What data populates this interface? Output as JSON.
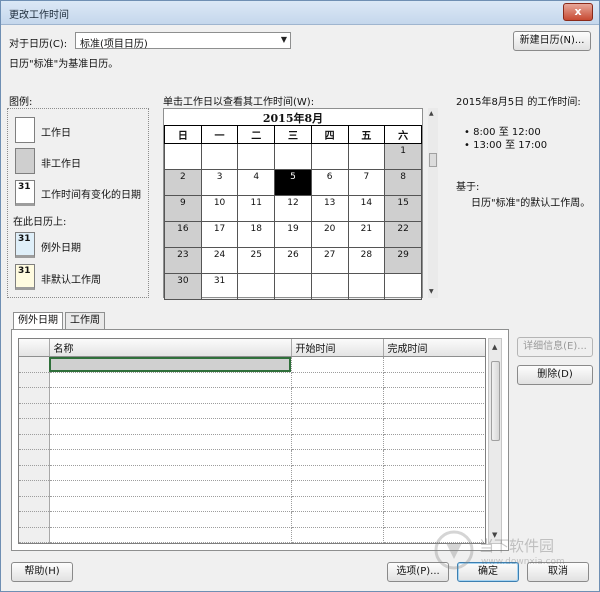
{
  "window": {
    "title": "更改工作时间",
    "close_label": "x"
  },
  "calendar_for": {
    "label": "对于日历(C):",
    "selected": "标准(项目日历)",
    "new_calendar_button": "新建日历(N)...",
    "base_info": "日历\"标准\"为基准日历。"
  },
  "legend": {
    "title": "图例:",
    "working": "工作日",
    "nonworking": "非工作日",
    "edited_swatch": "31",
    "edited": "工作时间有变化的日期",
    "on_this_calendar": "在此日历上:",
    "exception_swatch": "31",
    "exception": "例外日期",
    "nondefault_swatch": "31",
    "nondefault": "非默认工作周"
  },
  "calendar": {
    "instruction": "单击工作日以查看其工作时间(W):",
    "month_title": "2015年8月",
    "weekdays": [
      "日",
      "一",
      "二",
      "三",
      "四",
      "五",
      "六"
    ],
    "weeks": [
      [
        "",
        "",
        "",
        "",
        "",
        "",
        "1"
      ],
      [
        "2",
        "3",
        "4",
        "5",
        "6",
        "7",
        "8"
      ],
      [
        "9",
        "10",
        "11",
        "12",
        "13",
        "14",
        "15"
      ],
      [
        "16",
        "17",
        "18",
        "19",
        "20",
        "21",
        "22"
      ],
      [
        "23",
        "24",
        "25",
        "26",
        "27",
        "28",
        "29"
      ],
      [
        "30",
        "31",
        "",
        "",
        "",
        "",
        ""
      ]
    ],
    "selected_day": "5"
  },
  "work_times": {
    "heading": "2015年8月5日 的工作时间:",
    "slot1_start": "8:00",
    "slot1_sep": "至",
    "slot1_end": "12:00",
    "slot2_start": "13:00",
    "slot2_sep": "至",
    "slot2_end": "17:00",
    "based_on_label": "基于:",
    "based_on_text": "日历\"标准\"的默认工作周。"
  },
  "tabs": {
    "exceptions": "例外日期",
    "work_weeks": "工作周"
  },
  "exceptions_table": {
    "columns": {
      "name": "名称",
      "start": "开始时间",
      "finish": "完成时间"
    }
  },
  "side_buttons": {
    "details": "详细信息(E)...",
    "delete": "删除(D)"
  },
  "footer": {
    "help": "帮助(H)",
    "options": "选项(P)...",
    "ok": "确定",
    "cancel": "取消"
  },
  "watermark": {
    "brand": "当下软件园",
    "url": "www.downxia.com"
  }
}
